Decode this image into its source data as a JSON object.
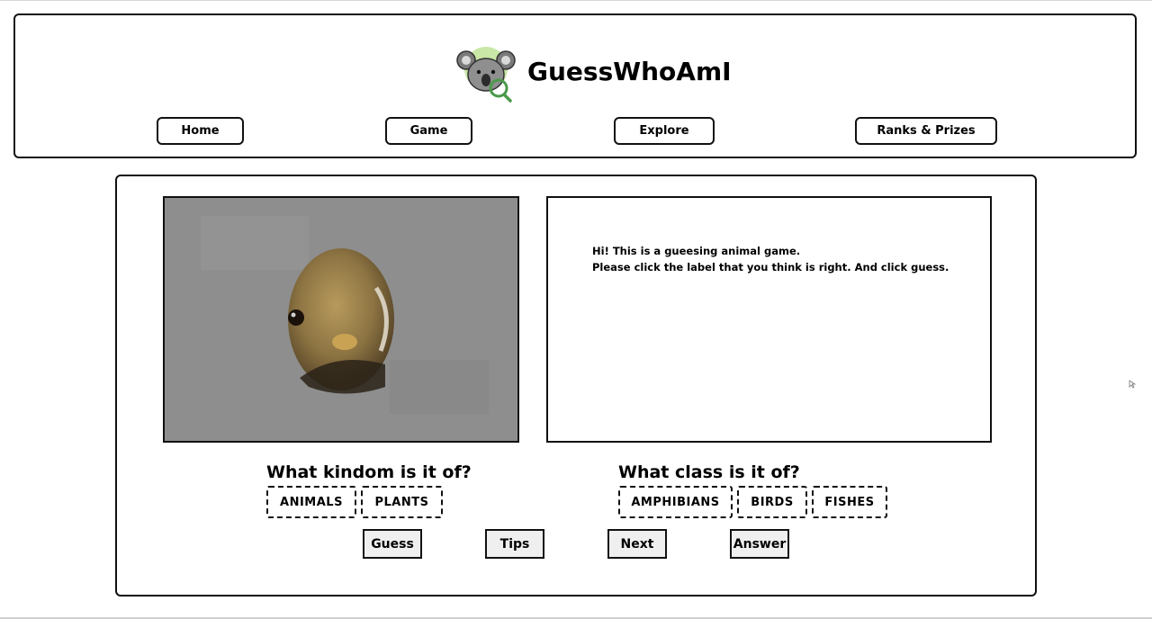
{
  "brand": {
    "name": "GuessWhoAmI",
    "logo_icon": "koala-magnifier-icon",
    "logo_colors": {
      "koala": "#8a8a8a",
      "circle": "#c9e7a6",
      "magnifier": "#4a9a4a"
    }
  },
  "nav": {
    "items": [
      {
        "label": "Home"
      },
      {
        "label": "Game"
      },
      {
        "label": "Explore"
      },
      {
        "label": "Ranks & Prizes"
      }
    ]
  },
  "game": {
    "image_icon": "frog-closeup-oval-image",
    "message": {
      "line1": "Hi! This is a gueesing animal game.",
      "line2": "Please click the label that you think is right. And click guess."
    },
    "kingdom": {
      "question": "What kindom is it of?",
      "options": [
        "ANIMALS",
        "PLANTS"
      ]
    },
    "class": {
      "question": "What class is it of?",
      "options": [
        "AMPHIBIANS",
        "BIRDS",
        "FISHES"
      ]
    },
    "actions": {
      "guess": "Guess",
      "tips": "Tips",
      "next": "Next",
      "answer": "Answer"
    }
  }
}
